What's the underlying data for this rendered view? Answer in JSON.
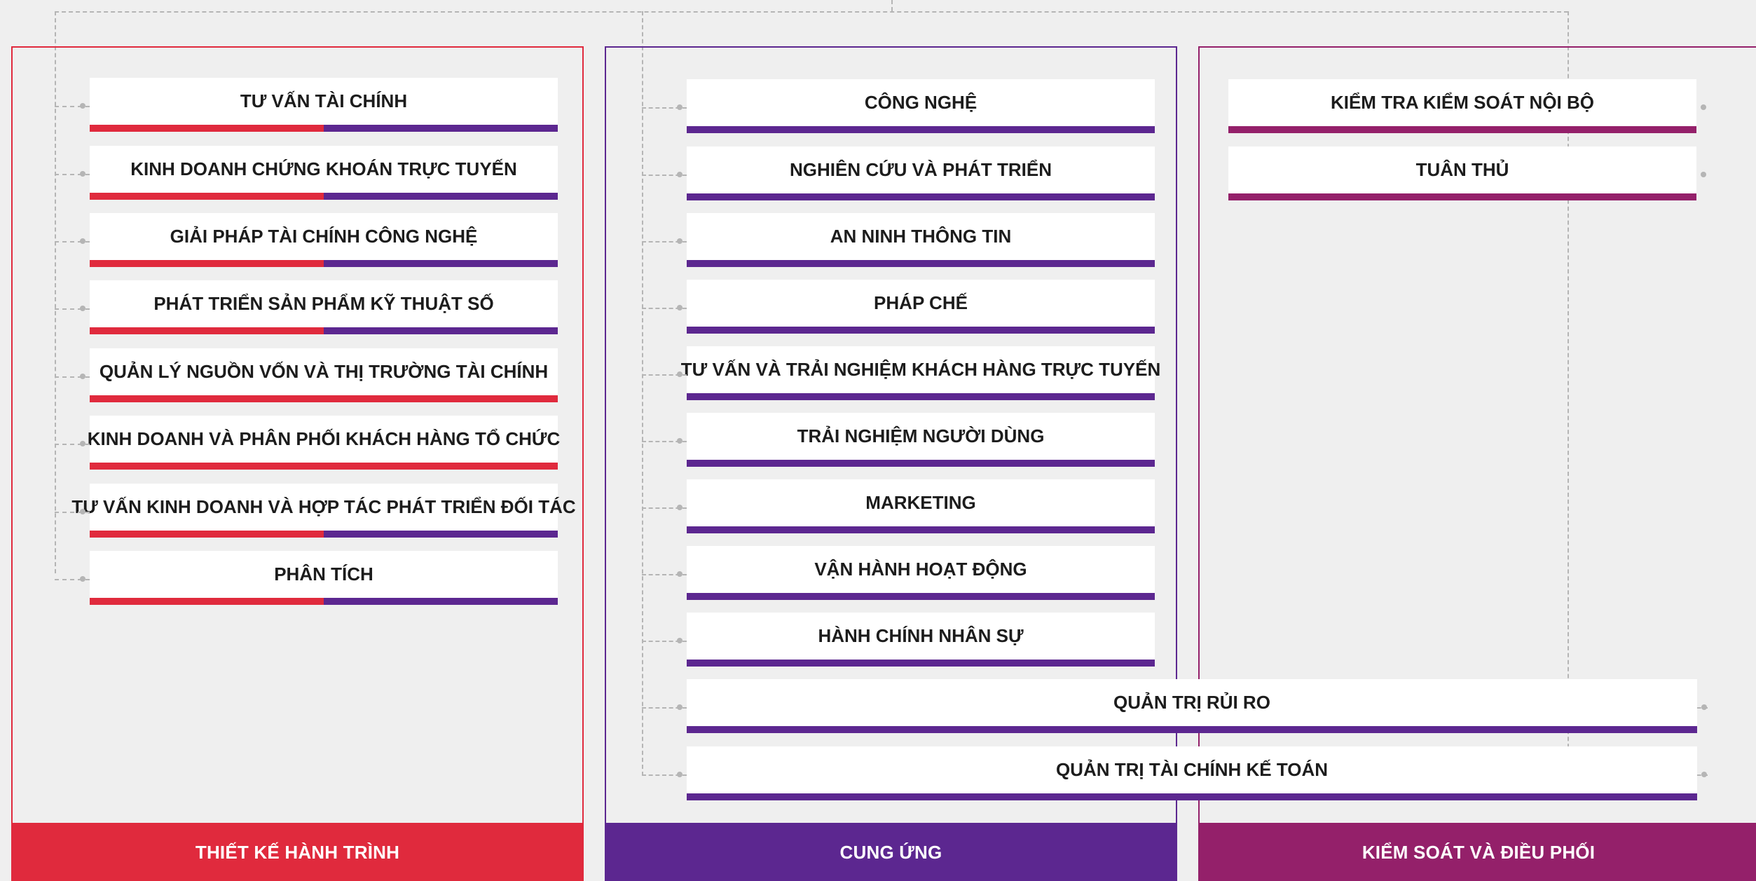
{
  "colors": {
    "red": "#e02a3d",
    "purple": "#5c2790",
    "magenta": "#94206a",
    "connector": "#b5b5b5",
    "background": "#efefef",
    "box": "#ffffff"
  },
  "columns": [
    {
      "id": "thiet-ke-hanh-trinh",
      "title": "THIẾT KẾ HÀNH TRÌNH",
      "accent": "#e02a3d"
    },
    {
      "id": "cung-ung",
      "title": "CUNG ỨNG",
      "accent": "#5c2790"
    },
    {
      "id": "kiem-soat-va-dieu-phoi",
      "title": "KIỂM SOÁT VÀ ĐIỀU PHỐI",
      "accent": "#94206a"
    }
  ],
  "boxes": {
    "journey": [
      {
        "label": "TƯ VẤN TÀI CHÍNH",
        "bar": [
          "#e02a3d",
          "#5c2790"
        ]
      },
      {
        "label": "KINH DOANH CHỨNG KHOÁN TRỰC TUYẾN",
        "bar": [
          "#e02a3d",
          "#5c2790"
        ]
      },
      {
        "label": "GIẢI PHÁP TÀI CHÍNH CÔNG NGHỆ",
        "bar": [
          "#e02a3d",
          "#5c2790"
        ]
      },
      {
        "label": "PHÁT TRIỂN SẢN PHẨM KỸ THUẬT SỐ",
        "bar": [
          "#e02a3d",
          "#5c2790"
        ]
      },
      {
        "label": "QUẢN LÝ NGUỒN VỐN VÀ THỊ TRƯỜNG TÀI CHÍNH",
        "bar": [
          "#e02a3d"
        ]
      },
      {
        "label": "KINH DOANH VÀ PHÂN PHỐI KHÁCH HÀNG TỔ CHỨC",
        "bar": [
          "#e02a3d"
        ]
      },
      {
        "label": "TƯ VẤN KINH DOANH VÀ HỢP TÁC PHÁT TRIỂN ĐỐI TÁC",
        "bar": [
          "#e02a3d",
          "#5c2790"
        ]
      },
      {
        "label": "PHÂN TÍCH",
        "bar": [
          "#e02a3d",
          "#5c2790"
        ]
      }
    ],
    "supply": [
      {
        "label": "CÔNG NGHỆ",
        "bar": [
          "#5c2790"
        ]
      },
      {
        "label": "NGHIÊN CỨU VÀ PHÁT TRIỂN",
        "bar": [
          "#5c2790"
        ]
      },
      {
        "label": "AN NINH THÔNG TIN",
        "bar": [
          "#5c2790"
        ]
      },
      {
        "label": "PHÁP CHẾ",
        "bar": [
          "#5c2790"
        ]
      },
      {
        "label": "TƯ VẤN VÀ TRẢI NGHIỆM KHÁCH HÀNG TRỰC TUYẾN",
        "bar": [
          "#5c2790"
        ]
      },
      {
        "label": "TRẢI NGHIỆM NGƯỜI DÙNG",
        "bar": [
          "#5c2790"
        ]
      },
      {
        "label": "MARKETING",
        "bar": [
          "#5c2790"
        ]
      },
      {
        "label": "VẬN HÀNH HOẠT ĐỘNG",
        "bar": [
          "#5c2790"
        ]
      },
      {
        "label": "HÀNH CHÍNH NHÂN SỰ",
        "bar": [
          "#5c2790"
        ]
      }
    ],
    "control": [
      {
        "label": "KIỂM TRA KIỂM SOÁT NỘI BỘ",
        "bar": [
          "#94206a"
        ]
      },
      {
        "label": "TUÂN THỦ",
        "bar": [
          "#94206a"
        ]
      }
    ],
    "shared": [
      {
        "label": "QUẢN TRỊ RỦI RO",
        "bar": [
          "#5c2790"
        ]
      },
      {
        "label": "QUẢN TRỊ TÀI CHÍNH KẾ TOÁN",
        "bar": [
          "#5c2790"
        ]
      }
    ]
  }
}
